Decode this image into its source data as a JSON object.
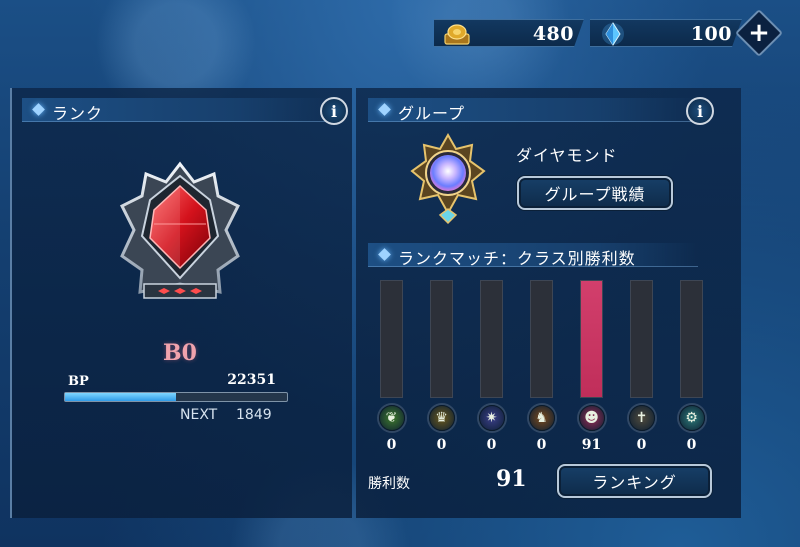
{
  "currency": {
    "gold": {
      "value": "480",
      "icon": "gold-coin-icon"
    },
    "crystal": {
      "value": "100",
      "icon": "crystal-icon"
    },
    "add_symbol": "+"
  },
  "rank_section": {
    "title": "ランク",
    "info": "i",
    "rank_name": "B0",
    "bp_label": "BP",
    "bp_value": "22351",
    "next_label": "NEXT",
    "next_value": "1849",
    "bp_progress": 0.5,
    "emblem_icon": "red-crystal-emblem-icon"
  },
  "group_section": {
    "title": "グループ",
    "info": "i",
    "group_name": "ダイヤモンド",
    "record_button": "グループ戦績",
    "emblem_icon": "diamond-emblem-icon"
  },
  "match_section": {
    "title": "ランクマッチ：クラス別勝利数",
    "wins_label": "勝利数",
    "wins_total": "91",
    "ranking_button": "ランキング"
  },
  "chart_data": {
    "type": "bar",
    "categories": [
      "elf",
      "royal",
      "witch",
      "dragon",
      "nightmare",
      "bishop",
      "nemesis"
    ],
    "values": [
      0,
      0,
      0,
      0,
      91,
      0,
      0
    ],
    "labels": [
      "0",
      "0",
      "0",
      "0",
      "91",
      "0",
      "0"
    ],
    "ylim": [
      0,
      91
    ],
    "icons": [
      "leaf-icon",
      "crown-icon",
      "magic-circle-icon",
      "dragon-icon",
      "demon-icon",
      "bishop-icon",
      "nemesis-icon"
    ],
    "icon_colors": [
      "#3f7a2c",
      "#6b5a1c",
      "#3b3f8a",
      "#7a4a1d",
      "#9a2d55",
      "#4f4a3c",
      "#2d7a78"
    ],
    "bar_color": "#c02e5a",
    "track_color": "#2c3039"
  },
  "colors": {
    "accent": "#9fd3ff",
    "rank_text": "#f0a3ad",
    "bp_bar": "#3aa3ee"
  }
}
